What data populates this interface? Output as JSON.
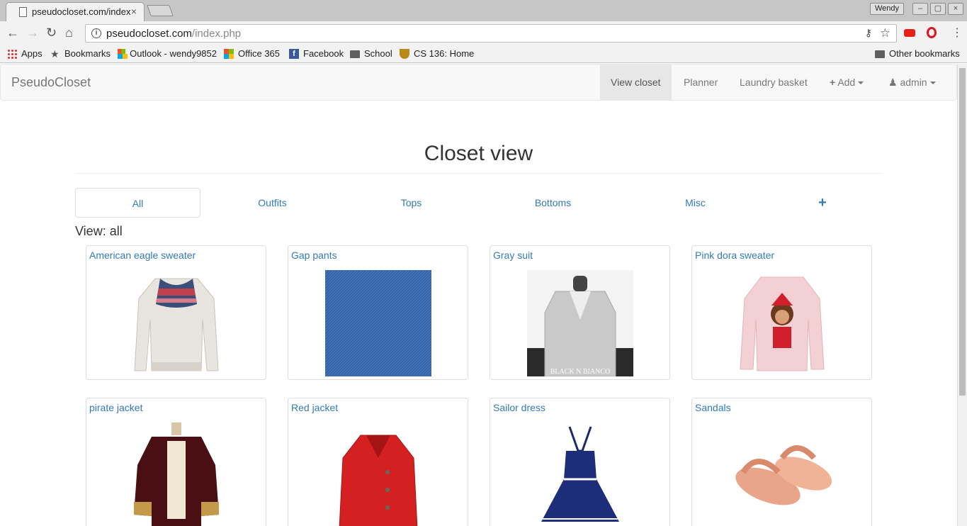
{
  "browser": {
    "tab_title": "pseudocloset.com/index.php",
    "tab_close": "×",
    "profile_name": "Wendy",
    "url_host": "pseudocloset.com",
    "url_path": "/index.php",
    "bookmarks": [
      {
        "label": "Apps",
        "icon": "apps-grid-icon"
      },
      {
        "label": "Bookmarks",
        "icon": "star-icon"
      },
      {
        "label": "Outlook - wendy9852",
        "icon": "microsoft-icon"
      },
      {
        "label": "Office 365",
        "icon": "microsoft-icon"
      },
      {
        "label": "Facebook",
        "icon": "facebook-icon"
      },
      {
        "label": "School",
        "icon": "folder-icon"
      },
      {
        "label": "CS 136: Home",
        "icon": "crest-icon"
      }
    ],
    "other_bookmarks": "Other bookmarks"
  },
  "site": {
    "brand": "PseudoCloset",
    "nav": {
      "view_closet": "View closet",
      "planner": "Planner",
      "laundry": "Laundry basket",
      "add": "Add",
      "admin": "admin"
    },
    "heading": "Closet view",
    "filters": {
      "all": "All",
      "outfits": "Outfits",
      "tops": "Tops",
      "bottoms": "Bottoms",
      "misc": "Misc",
      "plus": "+"
    },
    "view_label": "View: all",
    "items": [
      {
        "name": "American eagle sweater"
      },
      {
        "name": "Gap pants"
      },
      {
        "name": "Gray suit",
        "watermark": "BLACK N BIANCO"
      },
      {
        "name": "Pink dora sweater"
      },
      {
        "name": "pirate jacket"
      },
      {
        "name": "Red jacket"
      },
      {
        "name": "Sailor dress"
      },
      {
        "name": "Sandals"
      }
    ]
  },
  "colors": {
    "link": "#337ab7",
    "navbar_bg": "#f8f8f8",
    "active_nav_bg": "#e7e7e7"
  }
}
